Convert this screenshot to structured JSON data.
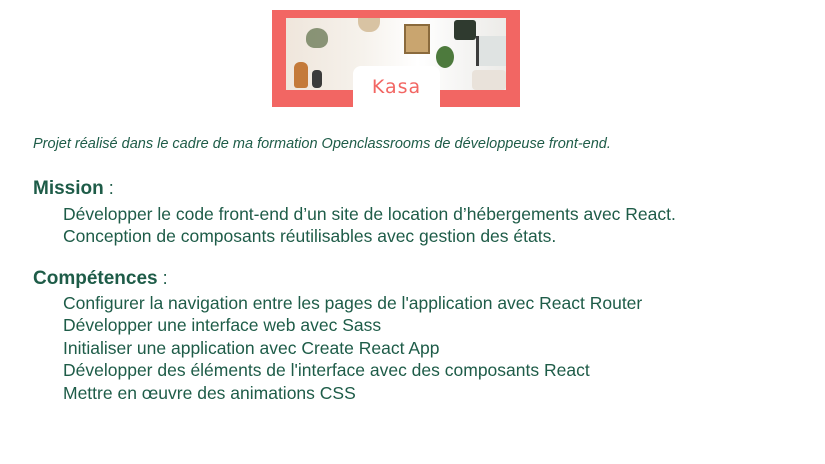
{
  "banner": {
    "logo_text": "Kasa",
    "brand_color": "#f26663"
  },
  "intro": "Projet réalisé dans le cadre de ma formation Openclassrooms de développeuse front-end.",
  "mission": {
    "title": "Mission",
    "colon": " :",
    "items": [
      "Développer le code front-end d’un site de location d’hébergements avec React.",
      "Conception de composants réutilisables avec gestion des états."
    ]
  },
  "competences": {
    "title": "Compétences",
    "colon": " :",
    "items": [
      "Configurer la navigation entre les pages de l'application avec React Router",
      "Développer une interface web avec Sass",
      "Initialiser une application avec Create React App",
      "Développer des éléments de l'interface avec des composants React",
      "Mettre en œuvre des animations CSS"
    ]
  },
  "colors": {
    "text": "#1e5c48",
    "background": "#ffffff"
  }
}
